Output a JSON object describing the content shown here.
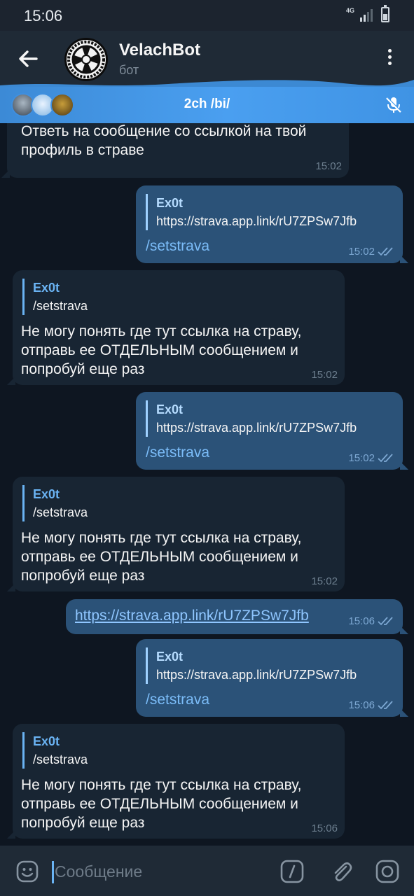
{
  "status": {
    "time": "15:06",
    "network": "4G"
  },
  "header": {
    "title": "VelachBot",
    "subtitle": "бот"
  },
  "voice_chat": {
    "title": "2ch /bi/"
  },
  "messages": [
    {
      "direction": "in",
      "text": "Ответь на сообщение со ссылкой на твой профиль в страве",
      "time": "15:02"
    },
    {
      "direction": "out",
      "reply_name": "Ex0t",
      "reply_text": "https://strava.app.link/rU7ZPSw7Jfb",
      "text": "/setstrava",
      "time": "15:02"
    },
    {
      "direction": "in",
      "reply_name": "Ex0t",
      "reply_text": "/setstrava",
      "text_lines": [
        "Не могу понять где тут ссылка на страву,",
        "отправь ее ОТДЕЛЬНЫМ сообщением и",
        "попробуй еще раз"
      ],
      "time": "15:02"
    },
    {
      "direction": "out",
      "reply_name": "Ex0t",
      "reply_text": "https://strava.app.link/rU7ZPSw7Jfb",
      "text": "/setstrava",
      "time": "15:02"
    },
    {
      "direction": "in",
      "reply_name": "Ex0t",
      "reply_text": "/setstrava",
      "text_lines": [
        "Не могу понять где тут ссылка на страву,",
        "отправь ее ОТДЕЛЬНЫМ сообщением и",
        "попробуй еще раз"
      ],
      "time": "15:02"
    },
    {
      "direction": "out",
      "link": "https://strava.app.link/rU7ZPSw7Jfb",
      "time": "15:06"
    },
    {
      "direction": "out",
      "reply_name": "Ex0t",
      "reply_text": "https://strava.app.link/rU7ZPSw7Jfb",
      "text": "/setstrava",
      "time": "15:06"
    },
    {
      "direction": "in",
      "reply_name": "Ex0t",
      "reply_text": "/setstrava",
      "text_lines": [
        "Не могу понять где тут ссылка на страву,",
        "отправь ее ОТДЕЛЬНЫМ сообщением и",
        "попробуй еще раз"
      ],
      "time": "15:06"
    }
  ],
  "input": {
    "placeholder": "Сообщение"
  },
  "icons": {
    "back": "arrow-left-icon",
    "more": "more-vert-icon",
    "mic_off": "mic-off-icon",
    "emoji": "emoji-icon",
    "command": "slash-command-icon",
    "attach": "paperclip-icon",
    "camera": "camera-icon",
    "read": "double-check-icon"
  },
  "colors": {
    "accent": "#6ab3f3",
    "voice_bar": "#4a9ff0",
    "bubble_out": "#2b5278",
    "bubble_in": "#182533",
    "background": "#0e1621"
  }
}
